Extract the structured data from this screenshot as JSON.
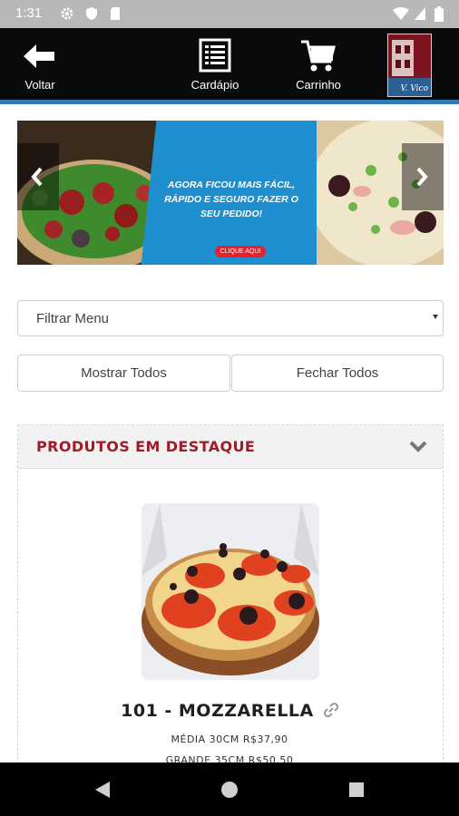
{
  "status_bar": {
    "time": "1:31"
  },
  "header": {
    "back_label": "Voltar",
    "menu_label": "Cardápio",
    "cart_label": "Carrinho",
    "logo_text": "V. Vico"
  },
  "banner": {
    "headline": "AGORA FICOU MAIS FÁCIL, RÁPIDO E SEGURO FAZER O SEU PEDIDO!",
    "cta": "CLIQUE AQUI"
  },
  "filter": {
    "label": "Filtrar Menu"
  },
  "actions": {
    "show_all": "Mostrar Todos",
    "close_all": "Fechar Todos"
  },
  "featured": {
    "title": "PRODUTOS EM DESTAQUE",
    "product": {
      "name": "101 - MOZZARELLA",
      "prices": [
        "MÉDIA 30CM R$37,90",
        "GRANDE 35CM R$50,50"
      ]
    }
  },
  "colors": {
    "accent": "#9d1c27",
    "header_bg": "#0a0a0a",
    "header_line": "#2f7fb7"
  }
}
